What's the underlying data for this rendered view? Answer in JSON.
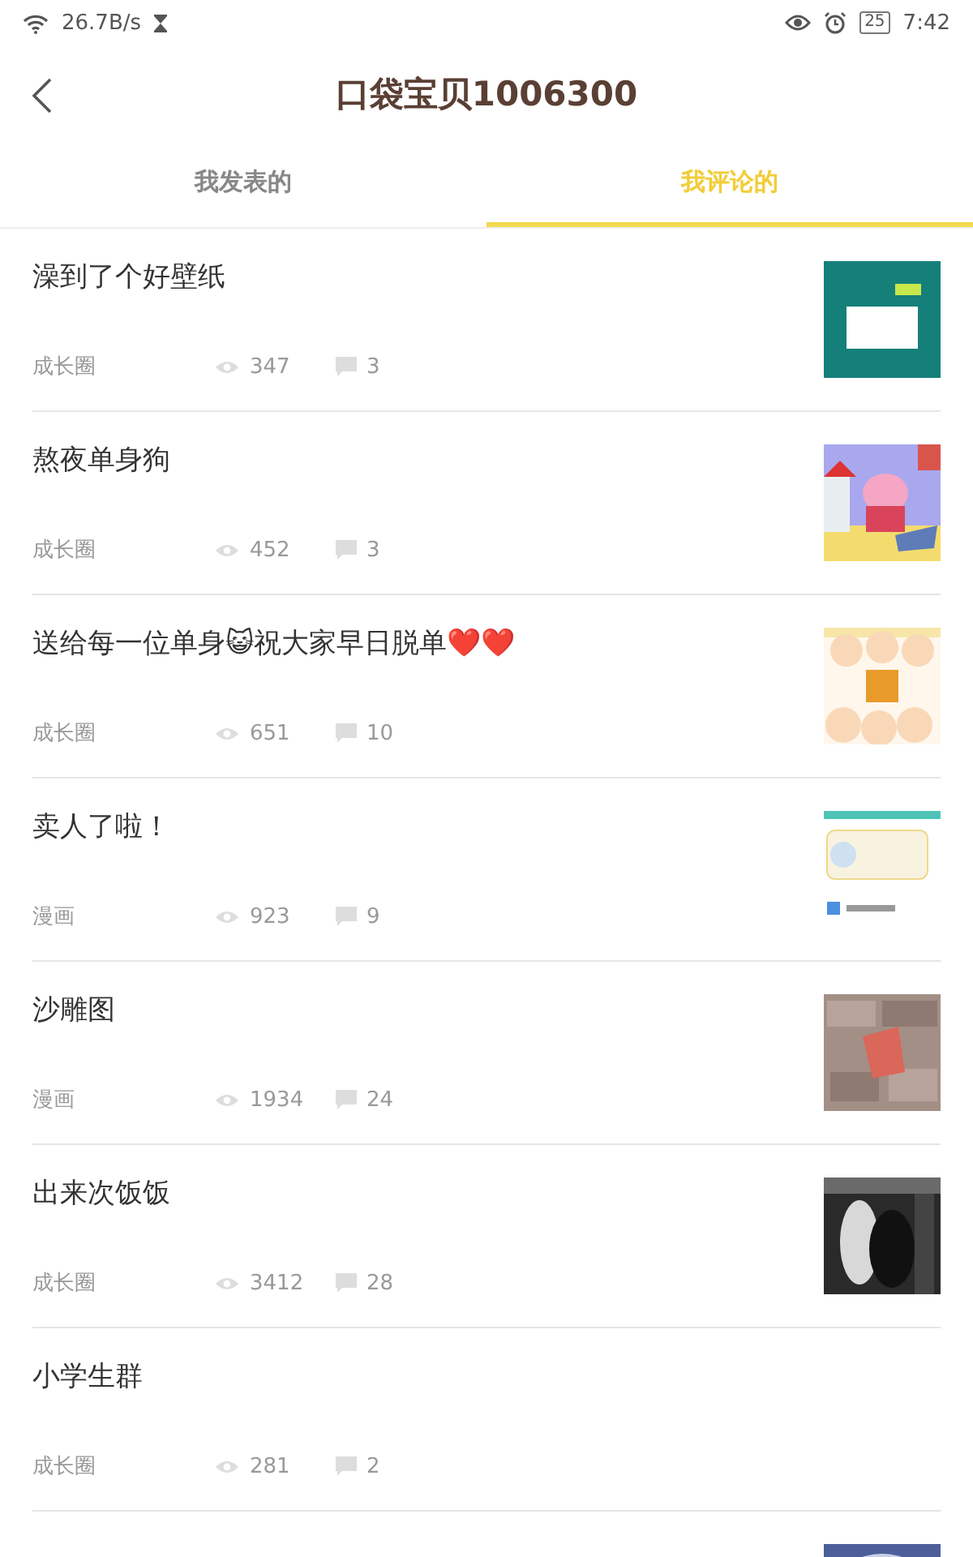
{
  "status_bar": {
    "speed": "26.7B/s",
    "battery": "25",
    "time": "7:42"
  },
  "header": {
    "title": "口袋宝贝1006300"
  },
  "tabs": [
    {
      "label": "我发表的",
      "selected": false
    },
    {
      "label": "我评论的",
      "selected": true
    }
  ],
  "posts": [
    {
      "title": "澡到了个好壁纸",
      "category": "成长圈",
      "views": "347",
      "comments": "3",
      "thumb": {
        "kind": "picture"
      }
    },
    {
      "title": "熬夜单身狗",
      "category": "成长圈",
      "views": "452",
      "comments": "3",
      "thumb": {
        "kind": "picture"
      }
    },
    {
      "title": "送给每一位单身😺祝大家早日脱单❤️❤️",
      "category": "成长圈",
      "views": "651",
      "comments": "10",
      "thumb": {
        "kind": "picture"
      }
    },
    {
      "title": "卖人了啦！",
      "category": "漫画",
      "views": "923",
      "comments": "9",
      "thumb": {
        "kind": "picture"
      }
    },
    {
      "title": "沙雕图",
      "category": "漫画",
      "views": "1934",
      "comments": "24",
      "thumb": {
        "kind": "picture"
      }
    },
    {
      "title": "出来次饭饭",
      "category": "成长圈",
      "views": "3412",
      "comments": "28",
      "thumb": {
        "kind": "picture"
      }
    },
    {
      "title": "小学生群",
      "category": "成长圈",
      "views": "281",
      "comments": "2"
    },
    {
      "thumb": {
        "kind": "picture"
      }
    }
  ]
}
